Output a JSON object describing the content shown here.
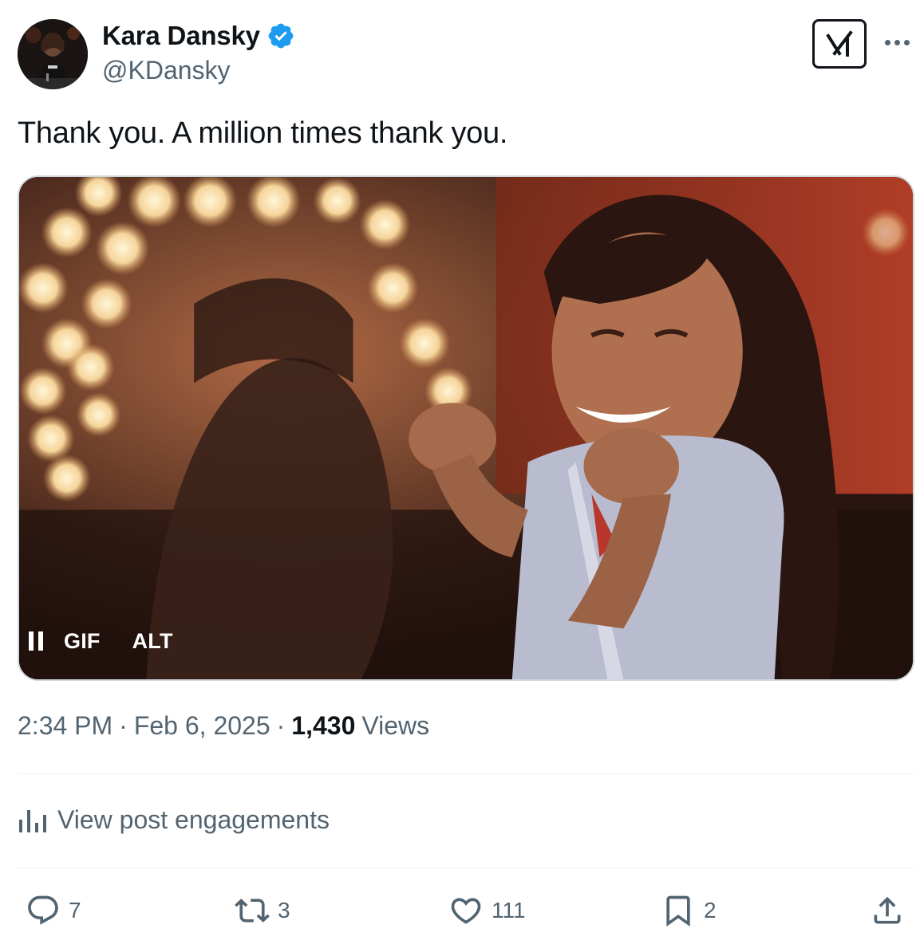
{
  "author": {
    "name": "Kara Dansky",
    "handle": "@KDansky",
    "verified": true,
    "verified_color": "#1d9bf0"
  },
  "header_icons": {
    "grok": "grok-icon",
    "more": "more-options-icon"
  },
  "tweet": {
    "text": "Thank you. A million times thank you."
  },
  "media": {
    "type": "gif",
    "controls": {
      "pause_icon": "pause-icon",
      "gif_label": "GIF",
      "alt_label": "ALT"
    }
  },
  "meta": {
    "time": "2:34 PM",
    "separator": "·",
    "date": "Feb 6, 2025",
    "views_count": "1,430",
    "views_label": "Views"
  },
  "engagements": {
    "icon": "bar-chart-icon",
    "label": "View post engagements"
  },
  "actions": {
    "reply": {
      "icon": "reply-icon",
      "count": "7"
    },
    "repost": {
      "icon": "repost-icon",
      "count": "3"
    },
    "like": {
      "icon": "heart-icon",
      "count": "111"
    },
    "bookmark": {
      "icon": "bookmark-icon",
      "count": "2"
    },
    "share": {
      "icon": "share-icon"
    }
  },
  "colors": {
    "text_primary": "#0f1419",
    "text_secondary": "#536471",
    "divider": "#eff3f4"
  }
}
